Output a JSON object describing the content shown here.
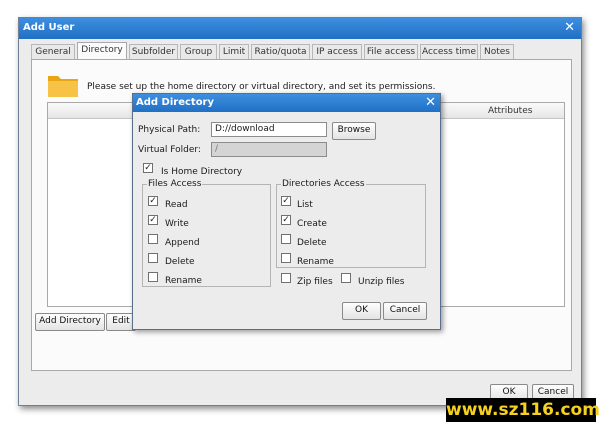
{
  "window": {
    "title": "Add User",
    "tabs": [
      "General",
      "Directory",
      "Subfolder",
      "Group",
      "Limit",
      "Ratio/quota",
      "IP access",
      "File access",
      "Access time",
      "Notes"
    ],
    "active_tab": "Directory"
  },
  "directory_tab": {
    "description": "Please set up the home directory or virtual directory, and set its permissions.",
    "grid_header_attributes": "Attributes",
    "add_directory_label": "Add Directory",
    "edit_label": "Edit"
  },
  "footer": {
    "ok_label": "OK",
    "cancel_label": "Cancel"
  },
  "dialog": {
    "title": "Add Directory",
    "physical_path_label": "Physical Path:",
    "physical_path_value": "D://download",
    "browse_label": "Browse",
    "virtual_folder_label": "Virtual Folder:",
    "virtual_folder_value": "/",
    "is_home_label": "Is Home Directory",
    "is_home_checked": true,
    "files_access": {
      "title": "Files Access",
      "items": [
        {
          "label": "Read",
          "checked": true
        },
        {
          "label": "Write",
          "checked": true
        },
        {
          "label": "Append",
          "checked": false
        },
        {
          "label": "Delete",
          "checked": false
        },
        {
          "label": "Rename",
          "checked": false
        }
      ]
    },
    "directories_access": {
      "title": "Directories Access",
      "items": [
        {
          "label": "List",
          "checked": true
        },
        {
          "label": "Create",
          "checked": true
        },
        {
          "label": "Delete",
          "checked": false
        },
        {
          "label": "Rename",
          "checked": false
        }
      ]
    },
    "zip_files_label": "Zip files",
    "unzip_files_label": "Unzip files",
    "ok_label": "OK",
    "cancel_label": "Cancel"
  },
  "watermark": "www.sz116.com",
  "colors": {
    "titlebar": "#2a7fd6",
    "watermark_text": "#f6d21e",
    "folder": "#f5b52a"
  }
}
